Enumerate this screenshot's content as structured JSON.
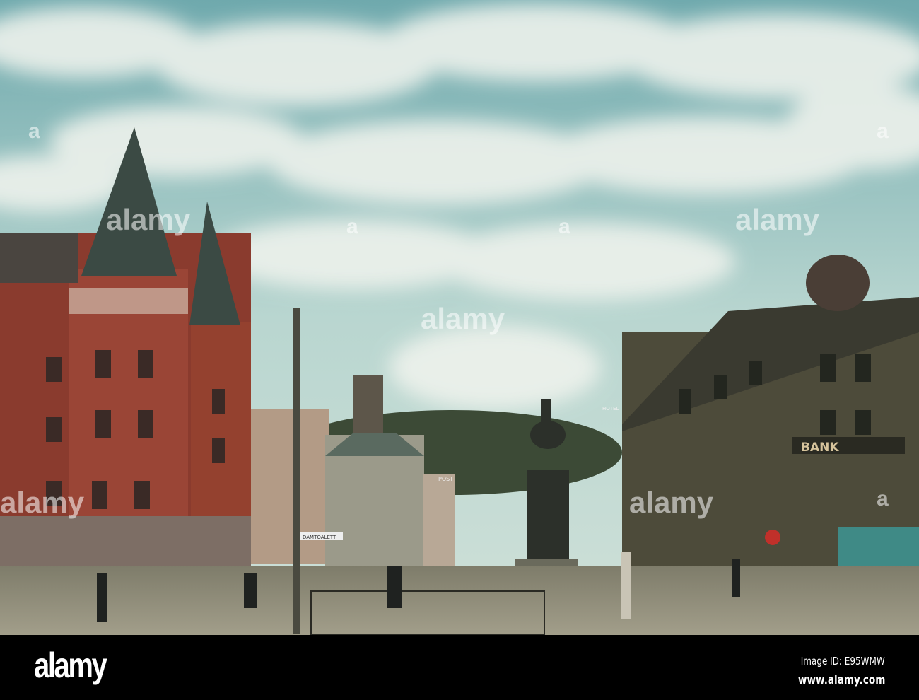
{
  "photo": {
    "signs": {
      "bank": "BANK",
      "post": "POST",
      "street_sign": "DAMTOALETT",
      "hotel": "HOTEL"
    },
    "watermarks": [
      "alamy",
      "a"
    ]
  },
  "footer": {
    "logo": "alamy",
    "image_id": "Image ID: E95WMW",
    "website": "www.alamy.com"
  },
  "colors": {
    "sky": "#9cc7c4",
    "brick": "#8a3b2e",
    "roof": "#3b4a44",
    "street": "#8d8a78",
    "footer": "#000000"
  }
}
